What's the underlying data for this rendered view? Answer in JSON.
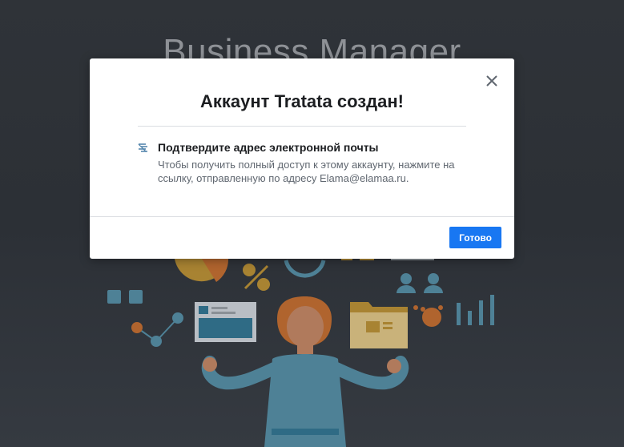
{
  "background": {
    "title": "Business Manager"
  },
  "modal": {
    "title": "Аккаунт Tratata создан!",
    "close_icon": "close-icon",
    "confirm": {
      "icon": "mail-icon",
      "heading": "Подтвердите адрес электронной почты",
      "text": "Чтобы получить полный доступ к этому аккаунту, нажмите на ссылку, отправленную по адресу Elama@elamaa.ru."
    },
    "done_label": "Готово"
  },
  "colors": {
    "accent": "#1877f2",
    "overlay_bg": "#2c3036",
    "illus_teal": "#4e8196",
    "illus_orange": "#c46a2a",
    "illus_yellow": "#c9a035"
  }
}
